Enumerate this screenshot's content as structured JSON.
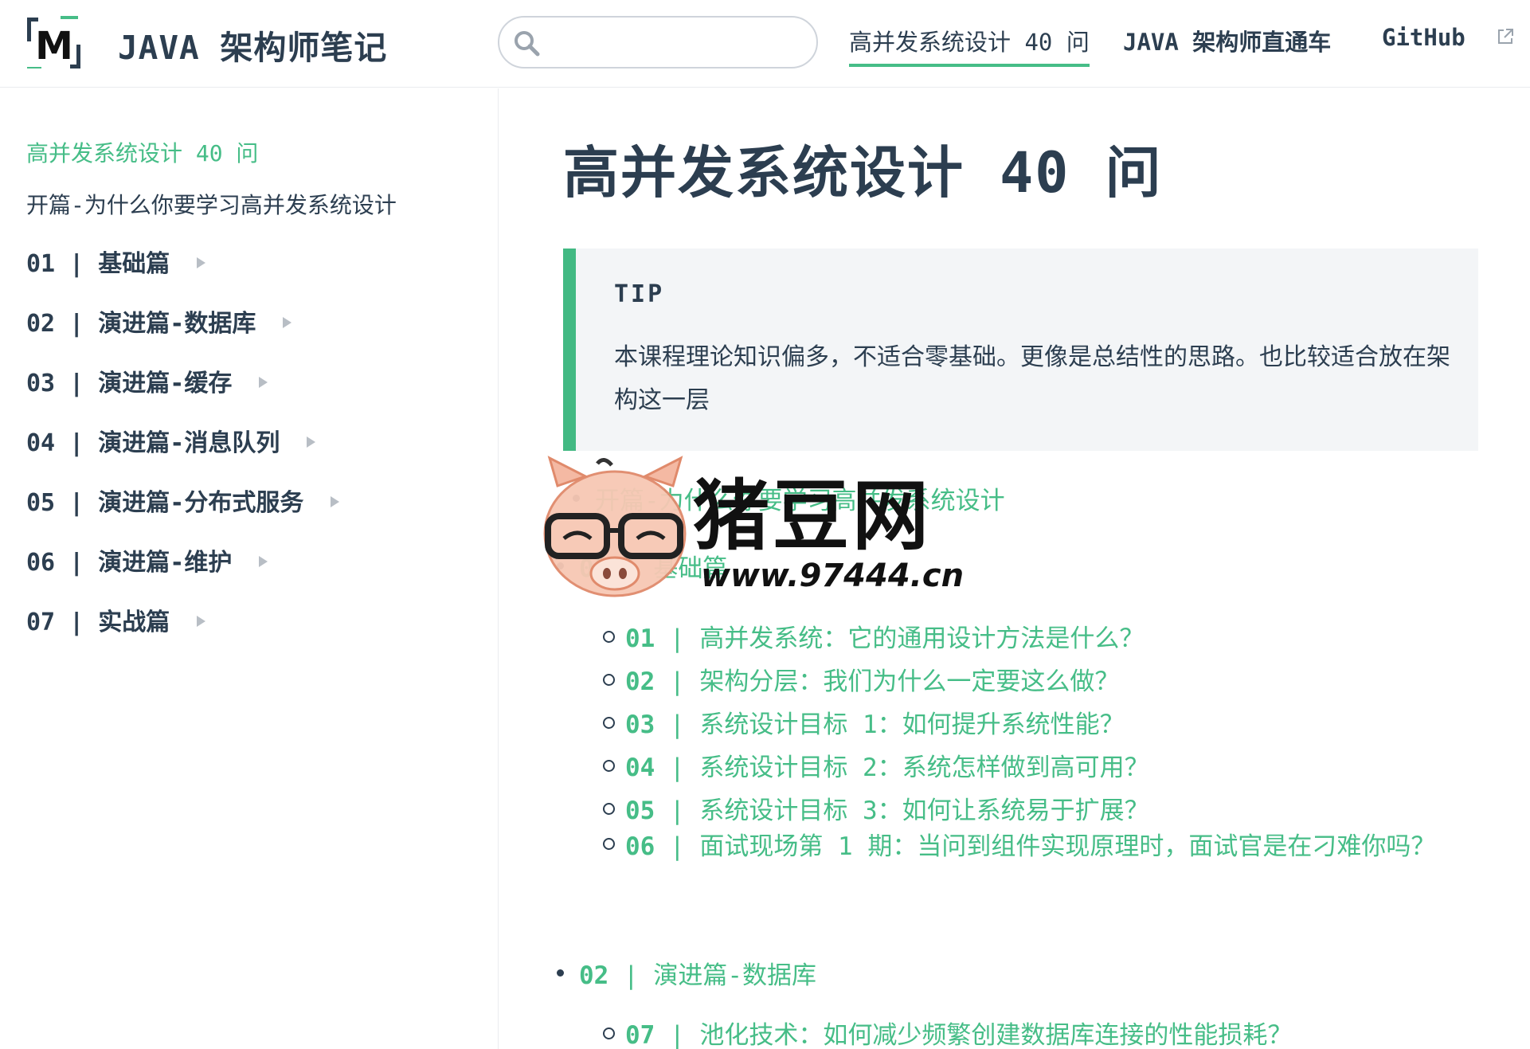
{
  "header": {
    "site_name": "JAVA 架构师笔记",
    "logo_text": "M",
    "search": {
      "value": "",
      "placeholder": ""
    },
    "nav": [
      {
        "label": "高并发系统设计 40 问",
        "active": true
      },
      {
        "label": "JAVA 架构师直通车",
        "active": false
      },
      {
        "label": "GitHub",
        "active": false,
        "external": true
      }
    ]
  },
  "sidebar": {
    "title": "高并发系统设计 40 问",
    "intro": "开篇-为什么你要学习高并发系统设计",
    "sections": [
      "01 | 基础篇",
      "02 | 演进篇-数据库",
      "03 | 演进篇-缓存",
      "04 | 演进篇-消息队列",
      "05 | 演进篇-分布式服务",
      "06 | 演进篇-维护",
      "07 | 实战篇"
    ]
  },
  "main": {
    "title": "高并发系统设计 40 问",
    "tip": {
      "title": "TIP",
      "body": "本课程理论知识偏多，不适合零基础。更像是总结性的思路。也比较适合放在架构这一层"
    },
    "toc": {
      "intro_link": "开篇-为什么你要学习高并发系统设计",
      "group1": {
        "num": "01",
        "label": "基础篇"
      },
      "group1_items": [
        {
          "num": "01",
          "text": "高并发系统：它的通用设计方法是什么？"
        },
        {
          "num": "02",
          "text": "架构分层：我们为什么一定要这么做？"
        },
        {
          "num": "03",
          "text": "系统设计目标 1：如何提升系统性能？"
        },
        {
          "num": "04",
          "text": "系统设计目标 2：系统怎样做到高可用？"
        },
        {
          "num": "05",
          "text": "系统设计目标 3：如何让系统易于扩展？"
        },
        {
          "num": "06",
          "text": "面试现场第 1 期：当问到组件实现原理时，面试官是在刁难你吗？"
        }
      ],
      "group2": {
        "num": "02",
        "label": "演进篇-数据库"
      },
      "group2_items": [
        {
          "num": "07",
          "text": "池化技术：如何减少频繁创建数据库连接的性能损耗？"
        }
      ]
    }
  },
  "watermark": {
    "brand": "猪豆网",
    "url": "www.97444.cn"
  },
  "colors": {
    "accent": "#46bd87",
    "text": "#2c3e50",
    "tip_bg": "#f3f5f7",
    "tip_border": "#42b983"
  }
}
